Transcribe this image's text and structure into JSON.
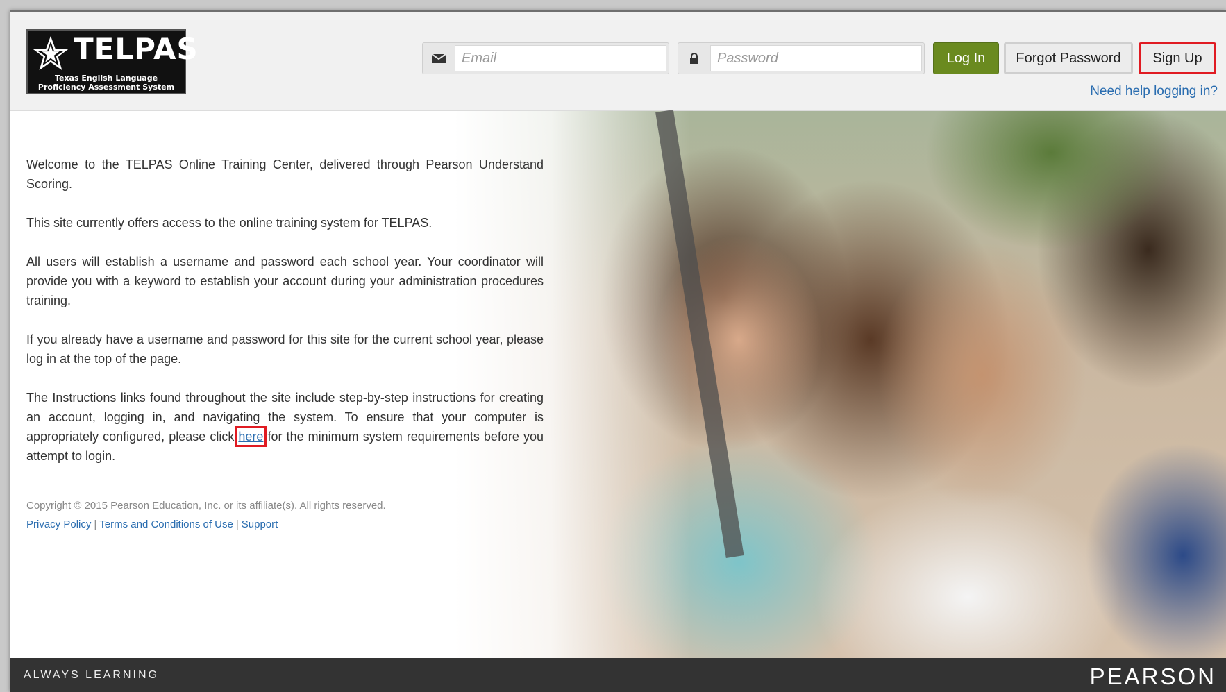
{
  "header": {
    "logo": {
      "word": "TELPAS",
      "subtitle_line1": "Texas English Language",
      "subtitle_line2": "Proficiency Assessment System"
    },
    "email_placeholder": "Email",
    "password_placeholder": "Password",
    "login_label": "Log In",
    "forgot_label": "Forgot Password",
    "signup_label": "Sign Up",
    "help_link": "Need help logging in?"
  },
  "main": {
    "paragraph1": "Welcome to the TELPAS Online Training Center, delivered through Pearson Understand Scoring.",
    "paragraph2": "This site currently offers access to the online training system for TELPAS.",
    "paragraph3": "All users will establish a username and password each school year. Your coordinator will provide you with a keyword to establish your account during your administration procedures training.",
    "paragraph4": "If you already have a username and password for this site for the current school year, please log in at the top of the page.",
    "paragraph5_before": "The Instructions links found throughout the site include step-by-step instructions for creating an account, logging in, and navigating the system. To ensure that your computer is appropriately configured, please click ",
    "paragraph5_link": "here",
    "paragraph5_after": " for the minimum system requirements before you attempt to login."
  },
  "legal": {
    "copyright": "Copyright © 2015 Pearson Education, Inc. or its affiliate(s). All rights reserved.",
    "privacy": "Privacy Policy",
    "terms": "Terms and Conditions of Use",
    "support": "Support",
    "separator": "|"
  },
  "footer": {
    "tagline": "ALWAYS LEARNING",
    "brand": "PEARSON"
  },
  "icons": {
    "email": "envelope-icon",
    "password": "lock-icon",
    "logo": "star-icon"
  },
  "colors": {
    "login_button": "#6a8a1f",
    "highlight_outline": "#e01b22",
    "link": "#2a6db0",
    "footer_bg": "#333333"
  }
}
